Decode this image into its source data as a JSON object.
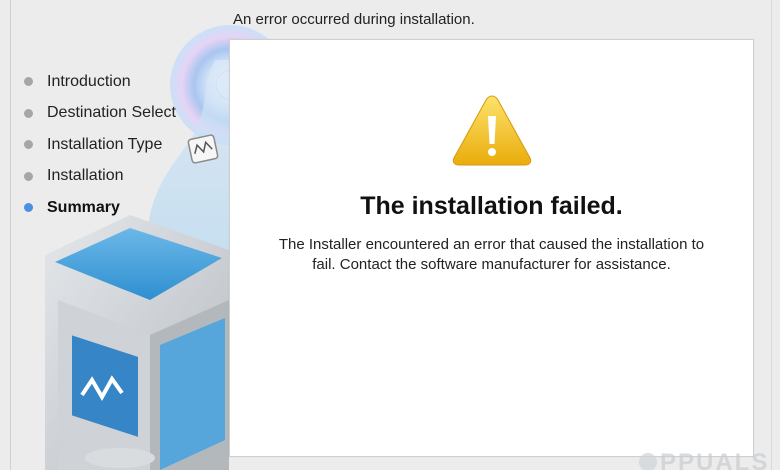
{
  "header": {
    "message": "An error occurred during installation."
  },
  "sidebar": {
    "steps": [
      {
        "label": "Introduction",
        "state": "done"
      },
      {
        "label": "Destination Select",
        "state": "done"
      },
      {
        "label": "Installation Type",
        "state": "done"
      },
      {
        "label": "Installation",
        "state": "done"
      },
      {
        "label": "Summary",
        "state": "current"
      }
    ]
  },
  "summary": {
    "icon": "warning-icon",
    "title": "The installation failed.",
    "description": "The Installer encountered an error that caused the installation to fail. Contact the software manufacturer for assistance."
  },
  "watermark": {
    "text": "APPUALS"
  },
  "colors": {
    "window_background": "#ececec",
    "panel_background": "#ffffff",
    "current_step_dot": "#4a90e2",
    "step_dot": "#a6a6a6",
    "warning_yellow": "#f5c518"
  }
}
